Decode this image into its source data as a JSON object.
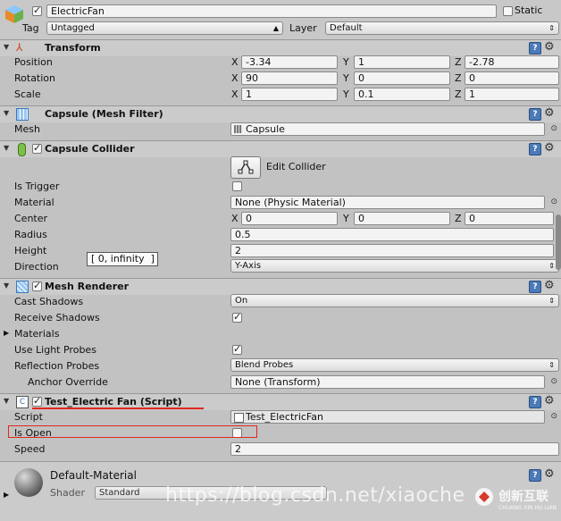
{
  "header": {
    "object_name": "ElectricFan",
    "static_label": "Static",
    "tag_label": "Tag",
    "tag_value": "Untagged",
    "layer_label": "Layer",
    "layer_value": "Default"
  },
  "transform": {
    "title": "Transform",
    "position_label": "Position",
    "rotation_label": "Rotation",
    "scale_label": "Scale",
    "x": "X",
    "y": "Y",
    "z": "Z",
    "position": [
      "-3.34",
      "1",
      "-2.78"
    ],
    "rotation": [
      "90",
      "0",
      "0"
    ],
    "scale": [
      "1",
      "0.1",
      "1"
    ]
  },
  "mesh_filter": {
    "title": "Capsule (Mesh Filter)",
    "mesh_label": "Mesh",
    "mesh_value": "Capsule"
  },
  "collider": {
    "title": "Capsule Collider",
    "edit_label": "Edit Collider",
    "is_trigger_label": "Is Trigger",
    "material_label": "Material",
    "material_value": "None (Physic Material)",
    "center_label": "Center",
    "center": [
      "0",
      "0",
      "0"
    ],
    "radius_label": "Radius",
    "radius_value": "0.5",
    "height_label": "Height",
    "height_value": "2",
    "direction_label": "Direction",
    "direction_value": "Y-Axis",
    "tooltip": "[ 0, infinity  ]"
  },
  "renderer": {
    "title": "Mesh Renderer",
    "cast_shadows_label": "Cast Shadows",
    "cast_shadows_value": "On",
    "receive_shadows_label": "Receive Shadows",
    "materials_label": "Materials",
    "light_probes_label": "Use Light Probes",
    "reflection_label": "Reflection Probes",
    "reflection_value": "Blend Probes",
    "anchor_label": "Anchor Override",
    "anchor_value": "None (Transform)"
  },
  "script": {
    "title": "Test_Electric Fan (Script)",
    "script_label": "Script",
    "script_value": "Test_ElectricFan",
    "is_open_label": "Is Open",
    "speed_label": "Speed",
    "speed_value": "2"
  },
  "material": {
    "name": "Default-Material",
    "shader_label": "Shader",
    "shader_value": "Standard"
  },
  "watermark": {
    "url": "https://blog.csdn.net/xiaoche",
    "brand": "创新互联",
    "brand_sub": "CHUANG XIN HU LIAN"
  },
  "colors": {
    "help_icon": "#4a7ab8",
    "highlight_red": "#e0261f"
  }
}
